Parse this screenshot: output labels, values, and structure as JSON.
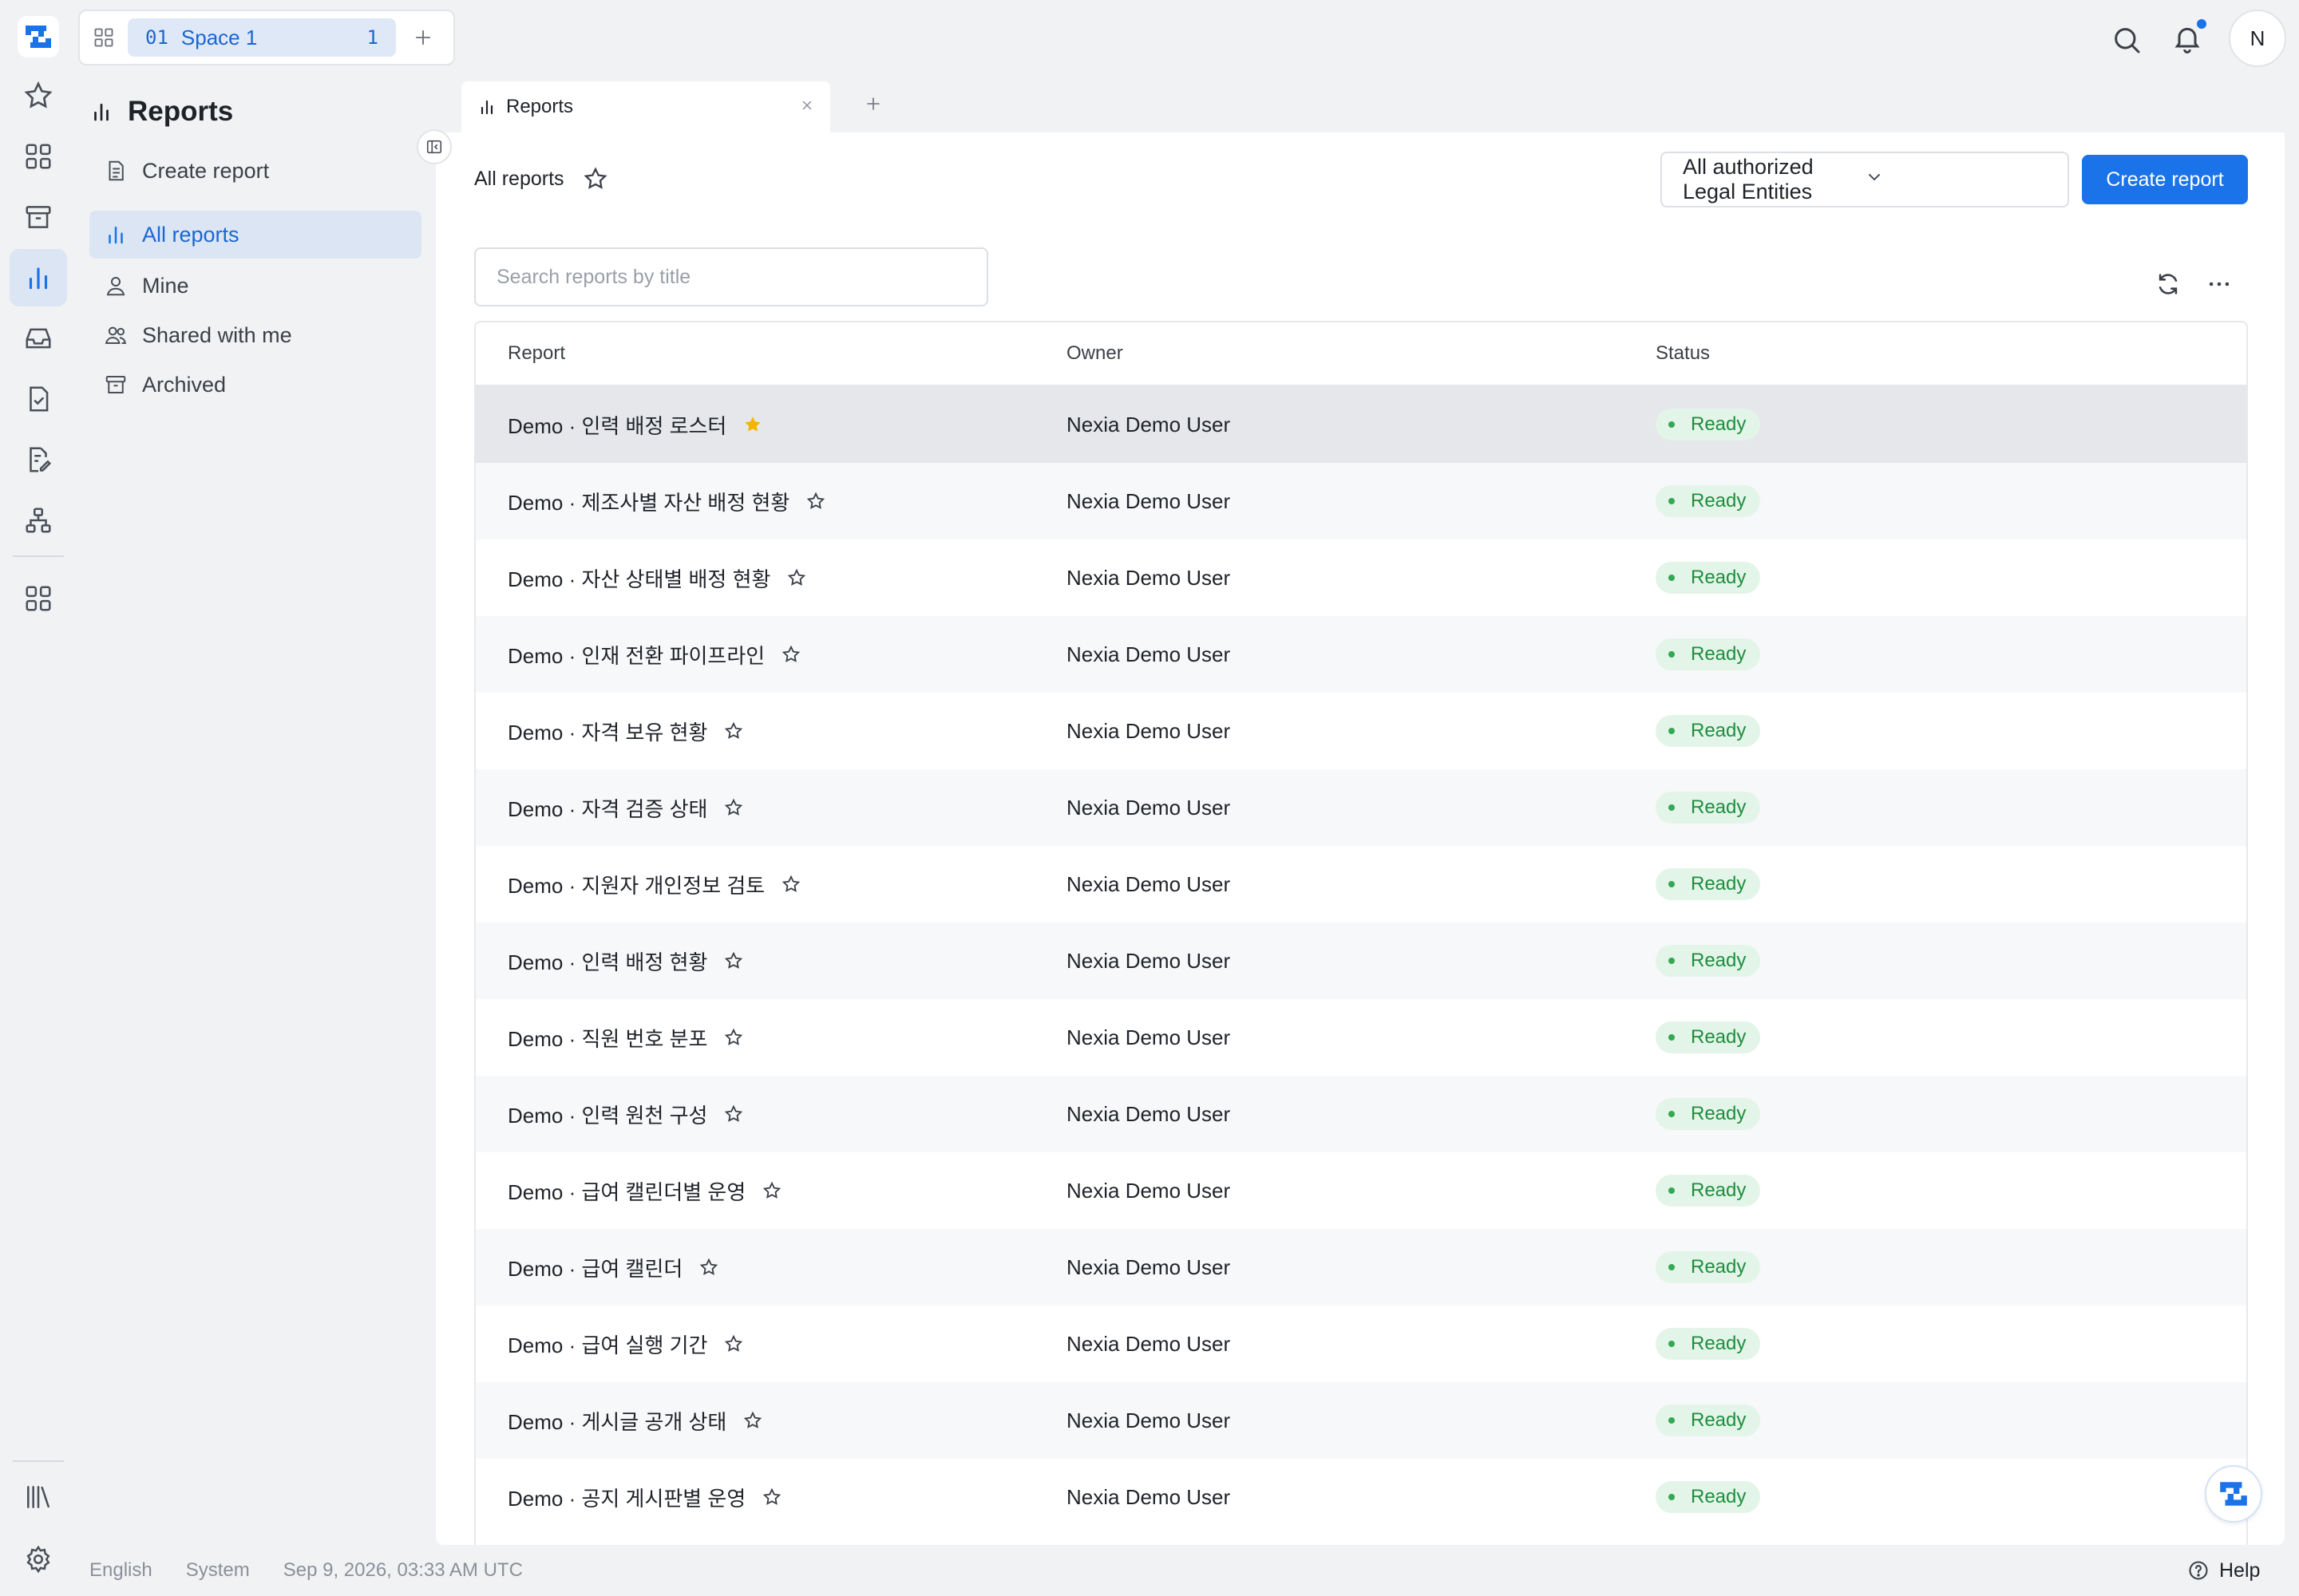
{
  "space": {
    "number": "01",
    "name": "Space 1",
    "count": "1"
  },
  "user": {
    "avatar_initial": "N"
  },
  "subnav": {
    "title": "Reports",
    "create_label": "Create report",
    "items": [
      {
        "label": "All reports",
        "icon": "bar-chart-icon",
        "active": true
      },
      {
        "label": "Mine",
        "icon": "user-icon"
      },
      {
        "label": "Shared with me",
        "icon": "users-icon"
      },
      {
        "label": "Archived",
        "icon": "archive-icon"
      }
    ]
  },
  "tab": {
    "label": "Reports"
  },
  "header": {
    "crumb": "All reports",
    "entity_select": "All authorized Legal Entities",
    "create_button": "Create report",
    "search_placeholder": "Search reports by title"
  },
  "table": {
    "columns": {
      "report": "Report",
      "owner": "Owner",
      "status": "Status"
    },
    "rows": [
      {
        "title": "Demo · 인력 배정 로스터",
        "owner": "Nexia Demo User",
        "status": "Ready",
        "starred": true
      },
      {
        "title": "Demo · 제조사별 자산 배정 현황",
        "owner": "Nexia Demo User",
        "status": "Ready",
        "starred": false
      },
      {
        "title": "Demo · 자산 상태별 배정 현황",
        "owner": "Nexia Demo User",
        "status": "Ready",
        "starred": false
      },
      {
        "title": "Demo · 인재 전환 파이프라인",
        "owner": "Nexia Demo User",
        "status": "Ready",
        "starred": false
      },
      {
        "title": "Demo · 자격 보유 현황",
        "owner": "Nexia Demo User",
        "status": "Ready",
        "starred": false
      },
      {
        "title": "Demo · 자격 검증 상태",
        "owner": "Nexia Demo User",
        "status": "Ready",
        "starred": false
      },
      {
        "title": "Demo · 지원자 개인정보 검토",
        "owner": "Nexia Demo User",
        "status": "Ready",
        "starred": false
      },
      {
        "title": "Demo · 인력 배정 현황",
        "owner": "Nexia Demo User",
        "status": "Ready",
        "starred": false
      },
      {
        "title": "Demo · 직원 번호 분포",
        "owner": "Nexia Demo User",
        "status": "Ready",
        "starred": false
      },
      {
        "title": "Demo · 인력 원천 구성",
        "owner": "Nexia Demo User",
        "status": "Ready",
        "starred": false
      },
      {
        "title": "Demo · 급여 캘린더별 운영",
        "owner": "Nexia Demo User",
        "status": "Ready",
        "starred": false
      },
      {
        "title": "Demo · 급여 캘린더",
        "owner": "Nexia Demo User",
        "status": "Ready",
        "starred": false
      },
      {
        "title": "Demo · 급여 실행 기간",
        "owner": "Nexia Demo User",
        "status": "Ready",
        "starred": false
      },
      {
        "title": "Demo · 게시글 공개 상태",
        "owner": "Nexia Demo User",
        "status": "Ready",
        "starred": false
      },
      {
        "title": "Demo · 공지 게시판별 운영",
        "owner": "Nexia Demo User",
        "status": "Ready",
        "starred": false
      }
    ]
  },
  "footer": {
    "language": "English",
    "theme": "System",
    "timestamp": "Sep 9, 2026, 03:33 AM UTC",
    "help": "Help"
  },
  "colors": {
    "accent": "#1a73e8",
    "active_bg": "#dce5f3",
    "ready_bg": "#e3f4e8",
    "ready_text": "#1e8e3e",
    "star_filled": "#f4b400"
  }
}
